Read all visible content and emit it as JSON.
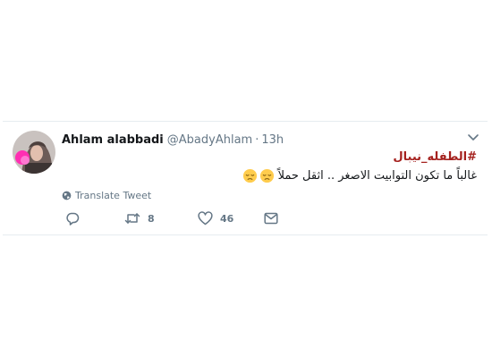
{
  "tweet": {
    "author_name": "Ahlam alabbadi",
    "handle": "@AbadyAhlam",
    "separator": "·",
    "time": "13h",
    "hashtag": "#الطفله_نيبال",
    "text": "غالباً ما تكون التوابيت الاصغر .. اثقل حملاً",
    "emojis": [
      "pensive-face-icon",
      "pensive-face-icon"
    ],
    "translate_label": "Translate Tweet",
    "counts": {
      "replies": "",
      "retweets": "8",
      "likes": "46"
    }
  },
  "colors": {
    "hashtag": "#a5211e",
    "text": "#14171a",
    "secondary": "#657786",
    "border": "#e6ecf0"
  }
}
